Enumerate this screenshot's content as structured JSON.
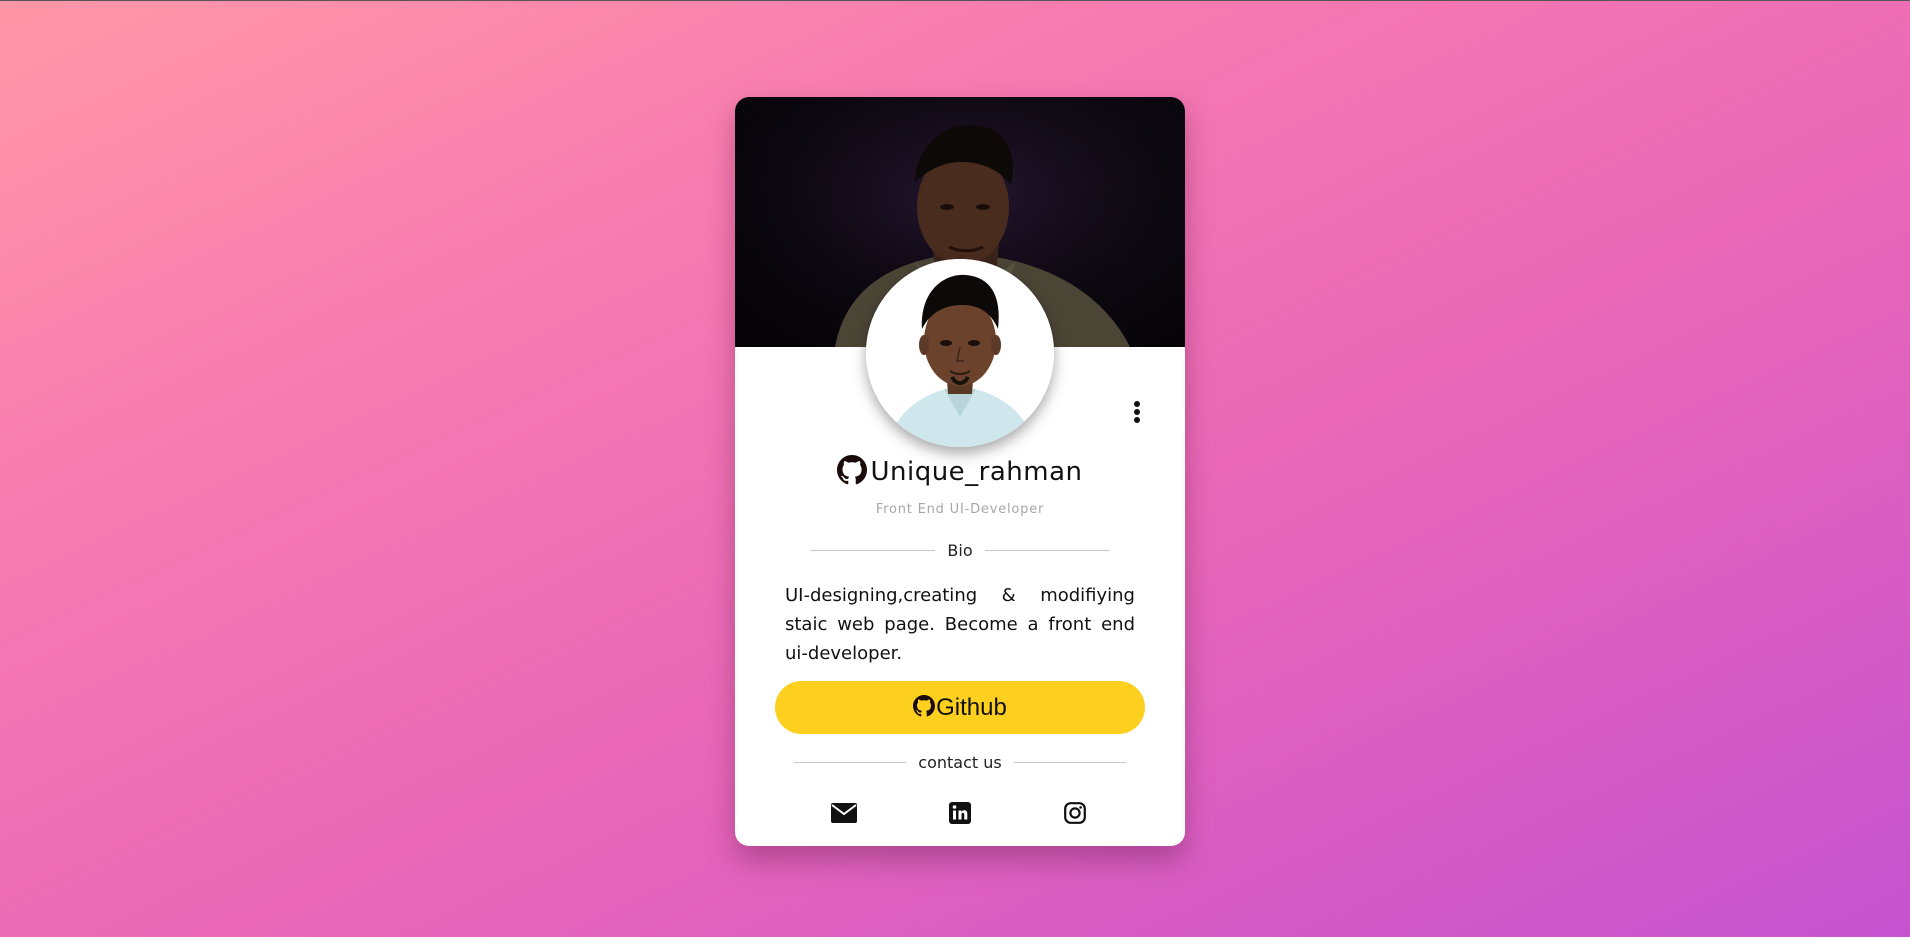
{
  "profile": {
    "username": "Unique_rahman",
    "role": "Front End UI-Developer",
    "bio_heading": "Bio",
    "bio_text": "UI-designing,creating & modifiying staic web page. Become a front end ui-developer.",
    "github_button_label": "Github",
    "contact_heading": "contact us"
  },
  "icons": {
    "name_icon": "github-icon",
    "button_icon": "github-icon",
    "menu": "more-vertical-icon",
    "social": [
      "email-icon",
      "linkedin-icon",
      "instagram-icon"
    ]
  },
  "colors": {
    "accent_button": "#fdd01f",
    "card_background": "#ffffff",
    "page_gradient_start": "#ff97a8",
    "page_gradient_end": "#c553d0"
  }
}
